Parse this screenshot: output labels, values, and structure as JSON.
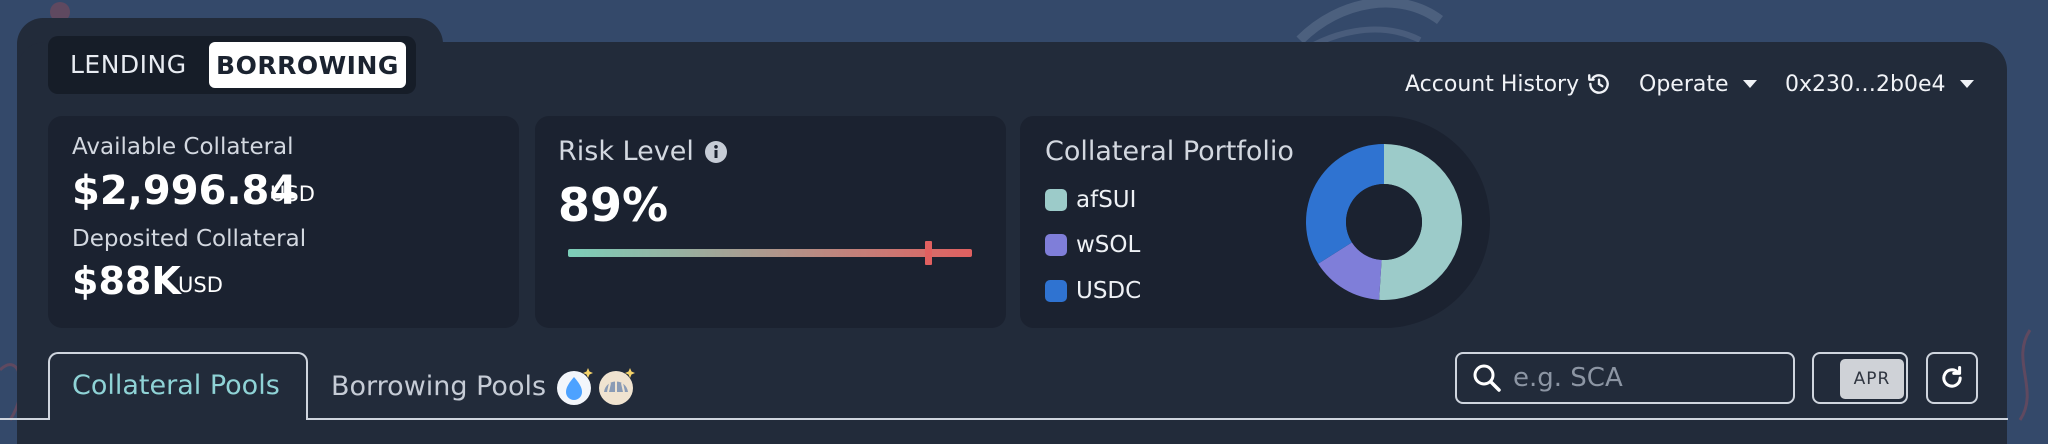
{
  "mode_toggle": {
    "lending_label": "LENDING",
    "borrowing_label": "BORROWING"
  },
  "header": {
    "account_history_label": "Account History",
    "operate_label": "Operate",
    "wallet_address": "0x230…2b0e4"
  },
  "collateral_card": {
    "available_label": "Available Collateral",
    "available_value": "$2,996.84",
    "available_unit": "USD",
    "deposited_label": "Deposited Collateral",
    "deposited_value": "$88K",
    "deposited_unit": "USD"
  },
  "risk_card": {
    "label": "Risk Level",
    "value": "89%",
    "level_fraction": 0.89,
    "gradient_colors": [
      "#7ccfb9",
      "#e06060"
    ]
  },
  "portfolio_card": {
    "title": "Collateral Portfolio",
    "items": [
      {
        "name": "afSUI",
        "color": "#9ccbc9",
        "share": 0.51
      },
      {
        "name": "wSOL",
        "color": "#7f7ed9",
        "share": 0.15
      },
      {
        "name": "USDC",
        "color": "#2f73d1",
        "share": 0.34
      }
    ]
  },
  "tabs": {
    "collateral_pools": "Collateral Pools",
    "borrowing_pools": "Borrowing Pools"
  },
  "search": {
    "placeholder": "e.g. SCA"
  },
  "apr_toggle": {
    "label": "APR"
  },
  "colors": {
    "accent_teal": "#8fd3d6",
    "panel": "#222b3a",
    "card": "#1b2230"
  }
}
